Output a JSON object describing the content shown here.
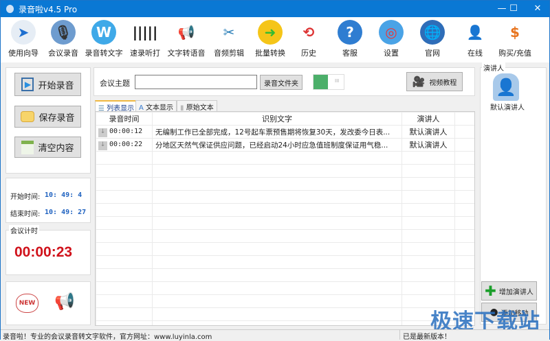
{
  "window": {
    "title": "录音啦v4.5 Pro",
    "minimize": "—",
    "maximize": "☐",
    "close": "✕"
  },
  "toolbar": [
    {
      "label": "使用向导",
      "icon": "navigation-arrow-icon",
      "color": "#e6edf5",
      "glyph": "➤",
      "fg": "#1e6fd0"
    },
    {
      "label": "会议录音",
      "icon": "microphone-icon",
      "color": "#6e9ccf",
      "glyph": "🎙",
      "fg": "#333"
    },
    {
      "label": "录音转文字",
      "icon": "w-app-icon",
      "color": "#3fa9e8",
      "glyph": "W",
      "fg": "#fff"
    },
    {
      "label": "速录听打",
      "icon": "sound-wave-icon",
      "color": "#ffffff",
      "glyph": "|||||",
      "fg": "#111"
    },
    {
      "label": "文字转语音",
      "icon": "megaphone-icon",
      "color": "#ffffff",
      "glyph": "📢",
      "fg": "#d33"
    },
    {
      "label": "音频剪辑",
      "icon": "scissors-icon",
      "color": "#ffffff",
      "glyph": "✂",
      "fg": "#2a7fb8"
    },
    {
      "label": "批量转换",
      "icon": "folder-arrow-icon",
      "color": "#f5c518",
      "glyph": "➜",
      "fg": "#3b3"
    },
    {
      "label": "历史",
      "icon": "history-clock-icon",
      "color": "#ffffff",
      "glyph": "⟲",
      "fg": "#d33"
    },
    {
      "label": "客服",
      "icon": "help-question-icon",
      "color": "#2f7dd1",
      "glyph": "?",
      "fg": "#fff"
    },
    {
      "label": "设置",
      "icon": "lifebuoy-icon",
      "color": "#4aa3e6",
      "glyph": "◎",
      "fg": "#e33"
    },
    {
      "label": "官网",
      "icon": "globe-icon",
      "color": "#2e6db8",
      "glyph": "🌐",
      "fg": "#fff"
    },
    {
      "label": "在线",
      "icon": "user-outline-icon",
      "color": "#ffffff",
      "glyph": "👤",
      "fg": "#2bb3b3"
    },
    {
      "label": "购买/充值",
      "icon": "dollar-coin-icon",
      "color": "#ffffff",
      "glyph": "$",
      "fg": "#e8741e"
    }
  ],
  "left": {
    "start": "开始录音",
    "save": "保存录音",
    "clear": "清空内容",
    "start_time_label": "开始时间:",
    "start_time": "10: 49: 4",
    "end_time_label": "结束时间:",
    "end_time": "10: 49: 27",
    "timer_label": "会议计时",
    "timer": "00:00:23",
    "new_badge": "NEW"
  },
  "main": {
    "topic_label": "会议主题",
    "topic_value": "",
    "folder_button": "录音文件夹",
    "toggle_on": true,
    "video_button": "视频教程",
    "tabs": [
      "列表显示",
      "文本显示",
      "原始文本"
    ],
    "columns": [
      "录音时间",
      "识别文字",
      "演讲人"
    ],
    "rows": [
      {
        "time": "00:00:12",
        "text": "无编制工作已全部完成，12号起车票预售期将恢复30天，发改委今日表...",
        "speaker": "默认演讲人"
      },
      {
        "time": "00:00:22",
        "text": "分地区天然气保证供应问题，已经启动24小时应急值班制度保证用气稳...",
        "speaker": "默认演讲人"
      }
    ]
  },
  "right": {
    "group_label": "演讲人",
    "speaker": "默认演讲人",
    "add_speaker": "增加演讲人",
    "second_button": "添加移动"
  },
  "status": {
    "left": "录音啦！专业的会议录音转文字软件，官方网址：www.luyinla.com",
    "right": "已是最新版本！"
  },
  "watermark": "极速下载站"
}
